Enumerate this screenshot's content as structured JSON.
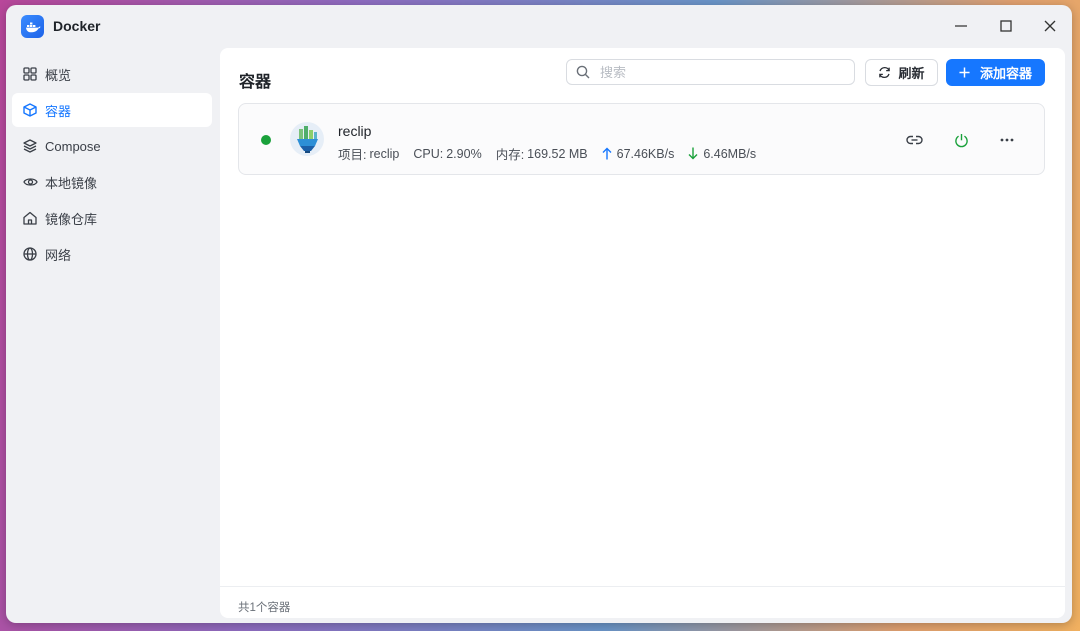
{
  "app": {
    "title": "Docker"
  },
  "sidebar": {
    "items": [
      {
        "label": "概览",
        "icon": "grid-icon",
        "active": false
      },
      {
        "label": "容器",
        "icon": "cube-icon",
        "active": true
      },
      {
        "label": "Compose",
        "icon": "layers-icon",
        "active": false
      },
      {
        "label": "本地镜像",
        "icon": "eye-icon",
        "active": false
      },
      {
        "label": "镜像仓库",
        "icon": "home-icon",
        "active": false
      },
      {
        "label": "网络",
        "icon": "globe-icon",
        "active": false
      }
    ]
  },
  "main": {
    "title": "容器",
    "search": {
      "placeholder": "搜索",
      "value": ""
    },
    "refresh_label": "刷新",
    "add_label": "添加容器",
    "containers": [
      {
        "name": "reclip",
        "status": "running",
        "project_label": "项目:",
        "project": "reclip",
        "cpu_label": "CPU:",
        "cpu": "2.90%",
        "mem_label": "内存:",
        "mem": "169.52 MB",
        "upload": "67.46KB/s",
        "download": "6.46MB/s"
      }
    ],
    "footer": "共1个容器"
  },
  "colors": {
    "accent": "#1677ff",
    "running": "#1aa13b",
    "power": "#1aa13b"
  }
}
